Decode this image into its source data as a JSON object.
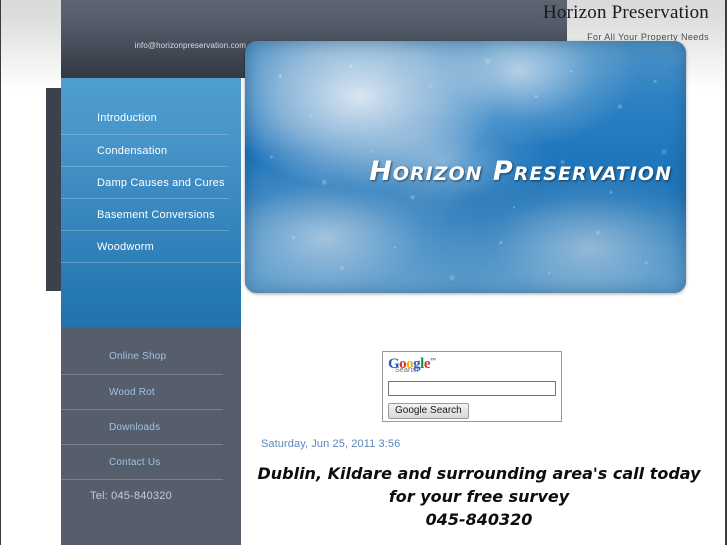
{
  "header": {
    "site_title": "Horizon Preservation",
    "tagline": "For All Your Property Needs",
    "email": "info@horizonpreservation.com"
  },
  "banner": {
    "logo_text": "Horizon Preservation",
    "alt": "water droplets on blue sky background"
  },
  "sidebar": {
    "primary_items": [
      {
        "label": "Introduction"
      },
      {
        "label": "Condensation"
      },
      {
        "label": "Damp Causes and Cures"
      },
      {
        "label": "Basement Conversions"
      },
      {
        "label": "Woodworm"
      }
    ],
    "secondary_items": [
      {
        "label": "Online Shop"
      },
      {
        "label": "Wood Rot"
      },
      {
        "label": "Downloads"
      },
      {
        "label": "Contact Us"
      }
    ],
    "telephone": "Tel: 045-840320"
  },
  "search": {
    "brand_g1": "G",
    "brand_o1": "o",
    "brand_o2": "o",
    "brand_g2": "g",
    "brand_l": "l",
    "brand_e": "e",
    "brand_tm": "™",
    "sub_label": "Search",
    "input_value": "",
    "input_placeholder": "",
    "button_label": "Google Search"
  },
  "main": {
    "date_line": "Saturday, Jun 25, 2011 3:56",
    "promo_line_1": "Dublin, Kildare and surrounding area's call today",
    "promo_line_2": "for your free survey",
    "promo_line_3": "045-840320"
  },
  "colors": {
    "nav_blue_top": "#4f9ed0",
    "nav_blue_bottom": "#2273ad",
    "nav_grey": "#565e6c",
    "header_dark": "#3b414d",
    "link_blue": "#9fc3e2",
    "date_blue": "#5b86b8"
  }
}
